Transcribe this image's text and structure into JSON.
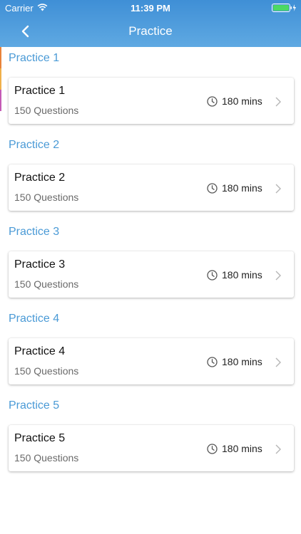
{
  "status_bar": {
    "carrier": "Carrier",
    "time": "11:39 PM",
    "icons": [
      "wifi-icon",
      "battery-icon"
    ],
    "battery_color": "#4cd964"
  },
  "nav": {
    "title": "Practice",
    "back_icon": "chevron-left-icon"
  },
  "colors": {
    "header_gradient_top": "#3f8fd6",
    "header_gradient_bottom": "#5fa9e2",
    "section_header": "#4a9ad6"
  },
  "sections": [
    {
      "header": "Practice 1",
      "title": "Practice 1",
      "questions": "150 Questions",
      "duration": "180 mins"
    },
    {
      "header": "Practice 2",
      "title": "Practice 2",
      "questions": "150 Questions",
      "duration": "180 mins"
    },
    {
      "header": "Practice 3",
      "title": "Practice 3",
      "questions": "150 Questions",
      "duration": "180 mins"
    },
    {
      "header": "Practice 4",
      "title": "Practice 4",
      "questions": "150 Questions",
      "duration": "180 mins"
    },
    {
      "header": "Practice 5",
      "title": "Practice 5",
      "questions": "150 Questions",
      "duration": "180 mins"
    }
  ]
}
